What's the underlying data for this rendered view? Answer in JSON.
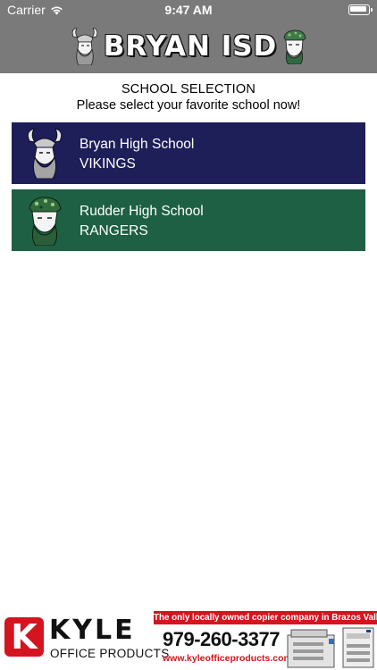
{
  "status_bar": {
    "carrier": "Carrier",
    "time": "9:47 AM"
  },
  "header": {
    "title": "BRYAN ISD"
  },
  "selection": {
    "title": "SCHOOL SELECTION",
    "subtitle": "Please select your favorite school now!"
  },
  "schools": [
    {
      "name": "Bryan High School",
      "mascot": "VIKINGS",
      "color": "#1e1f58"
    },
    {
      "name": "Rudder High School",
      "mascot": "RANGERS",
      "color": "#1d6043"
    }
  ],
  "ad": {
    "logo_letter": "K",
    "brand": "KYLE",
    "brand_sub": "OFFICE PRODUCTS",
    "tagline": "The only locally owned copier company in Brazos Valley!",
    "phone": "979-260-3377",
    "url": "www.kyleofficeproducts.com",
    "accent_color": "#d4141e"
  },
  "colors": {
    "header_bg": "#7a7a7a"
  },
  "icons": {
    "wifi": "wifi-icon",
    "battery": "battery-icon",
    "viking": "viking-logo-icon",
    "ranger": "ranger-logo-icon"
  }
}
